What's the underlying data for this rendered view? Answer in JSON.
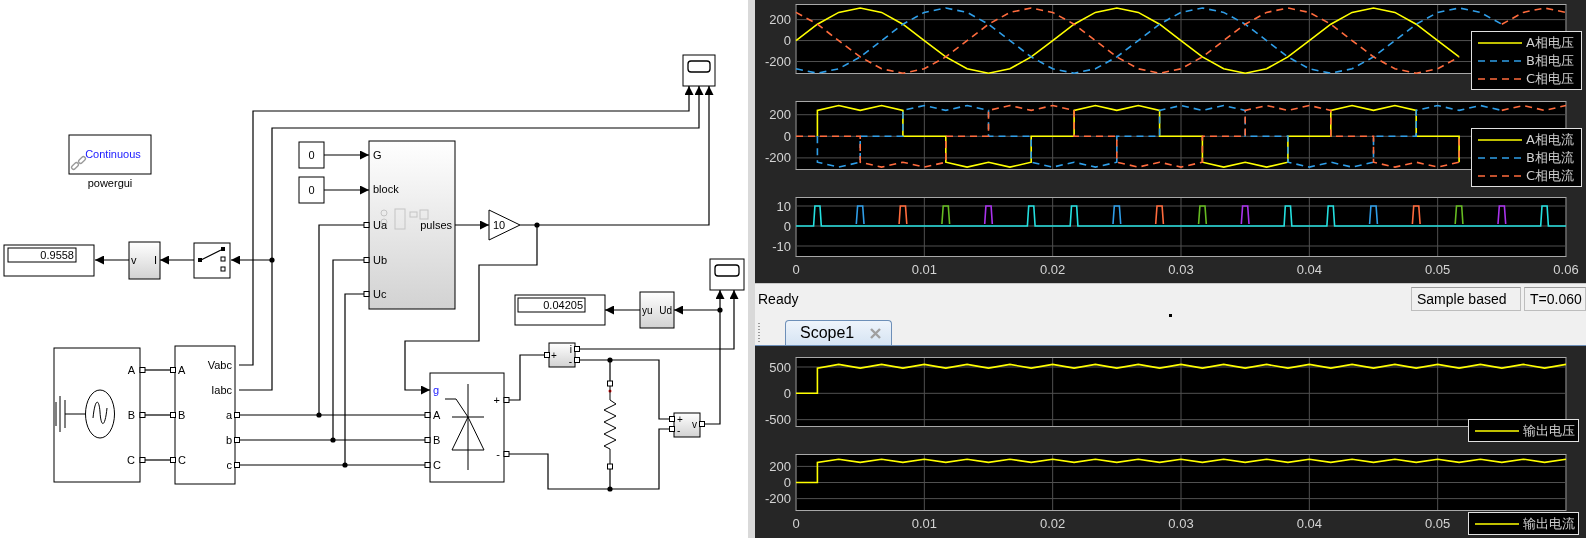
{
  "diagram": {
    "powergui": {
      "mode": "Continuous",
      "caption": "powergui"
    },
    "displays": [
      {
        "value": "0.9558"
      },
      {
        "value": "0.04205"
      }
    ],
    "converter": {
      "left_label": "v",
      "right_label": "I"
    },
    "constants": [
      {
        "value": "0"
      },
      {
        "value": "0"
      }
    ],
    "pulse_generator": {
      "inputs": [
        "G",
        "block",
        "Ua",
        "Ub",
        "Uc"
      ],
      "output": "pulses"
    },
    "gain": {
      "value": "10"
    },
    "ud_block": {
      "left_label": "yu",
      "right_label": "Ud"
    },
    "source": {
      "ports": [
        "A",
        "B",
        "C"
      ]
    },
    "measurement": {
      "inputs": [
        "A",
        "B",
        "C"
      ],
      "outputs": [
        "Vabc",
        "Iabc",
        "a",
        "b",
        "c"
      ]
    },
    "bridge": {
      "gate": "g",
      "inputs": [
        "A",
        "B",
        "C"
      ],
      "outputs": [
        "+",
        "-"
      ]
    },
    "current_meter": {
      "input": "+",
      "outputs": [
        "i",
        "-"
      ]
    },
    "voltage_meter": {
      "inputs": [
        "+",
        "-"
      ],
      "output": "v"
    }
  },
  "scope_window": {
    "axes": [
      {
        "legend": true,
        "chart_data": {
          "type": "line",
          "grid": true,
          "xlim": [
            0,
            0.06
          ],
          "ylim": [
            -319,
            349
          ],
          "yticks": [
            -200,
            0,
            200
          ],
          "x": [
            0,
            0.00167,
            0.00333,
            0.005,
            0.00667,
            0.00833,
            0.01,
            0.01167,
            0.01333,
            0.015,
            0.01667,
            0.01833,
            0.02,
            0.02167,
            0.02333,
            0.025,
            0.02667,
            0.02833,
            0.03,
            0.03167,
            0.03333,
            0.035,
            0.03667,
            0.03833,
            0.04,
            0.04167,
            0.04333,
            0.045,
            0.04667,
            0.04833,
            0.05,
            0.05167,
            0.05333,
            0.055,
            0.05667,
            0.05833,
            0.06
          ],
          "series": [
            {
              "name": "A相电压",
              "color": "#ffff00",
              "line_style": "solid",
              "values": [
                0,
                156,
                269,
                311,
                269,
                156,
                0,
                -156,
                -269,
                -311,
                -269,
                -156,
                0,
                156,
                269,
                311,
                269,
                156,
                0,
                -156,
                -269,
                -311,
                -269,
                -156,
                0,
                156,
                269,
                311,
                269,
                156,
                0,
                -156,
                null,
                null,
                null,
                null,
                null
              ]
            },
            {
              "name": "B相电压",
              "color": "#2f9ee8",
              "line_style": "dashed",
              "values": [
                -269,
                -311,
                -269,
                -156,
                0,
                156,
                269,
                311,
                269,
                156,
                0,
                -156,
                -269,
                -311,
                -269,
                -156,
                0,
                156,
                269,
                311,
                269,
                156,
                0,
                -156,
                -269,
                -311,
                -269,
                -156,
                0,
                156,
                269,
                311,
                269,
                156,
                null,
                null,
                null
              ]
            },
            {
              "name": "C相电压",
              "color": "#ff6b3d",
              "line_style": "dashed",
              "values": [
                269,
                156,
                0,
                -156,
                -269,
                -311,
                -269,
                -156,
                0,
                156,
                269,
                311,
                269,
                156,
                0,
                -156,
                -269,
                -311,
                -269,
                -156,
                0,
                156,
                269,
                311,
                269,
                156,
                0,
                -156,
                -269,
                -311,
                -269,
                -156,
                null,
                156,
                269,
                311,
                269
              ]
            }
          ]
        }
      },
      {
        "legend": true,
        "chart_data": {
          "type": "line",
          "grid": true,
          "xlim": [
            0,
            0.06
          ],
          "ylim": [
            -312,
            327
          ],
          "yticks": [
            -200,
            0,
            200
          ],
          "x": [
            0,
            0.00167,
            0.00167,
            0.00333,
            0.005,
            0.005,
            0.00667,
            0.00833,
            0.00833,
            0.01,
            0.01167,
            0.01167,
            0.01333,
            0.015,
            0.015,
            0.01667,
            0.01833,
            0.01833,
            0.02,
            0.02167,
            0.02167,
            0.02333,
            0.025,
            0.025,
            0.02667,
            0.02833,
            0.02833,
            0.03,
            0.03167,
            0.03167,
            0.03333,
            0.035,
            0.035,
            0.03667,
            0.03833,
            0.03833,
            0.04,
            0.04167,
            0.04167,
            0.04333,
            0.045,
            0.045,
            0.04667,
            0.04833,
            0.04833,
            0.05,
            0.05167,
            0.05167,
            0.05333,
            0.055,
            0.055,
            0.05667,
            0.05833,
            0.05833,
            0.06
          ],
          "series": [
            {
              "name": "A相电流",
              "color": "#ffff00",
              "line_style": "solid",
              "values": [
                null,
                0,
                240,
                285,
                240,
                240,
                285,
                240,
                0,
                0,
                0,
                -240,
                -285,
                -240,
                -240,
                -285,
                -240,
                0,
                0,
                0,
                240,
                285,
                240,
                240,
                285,
                240,
                0,
                0,
                0,
                -240,
                -285,
                -240,
                -240,
                -285,
                -240,
                0,
                0,
                0,
                240,
                285,
                240,
                240,
                285,
                240,
                0,
                0,
                0,
                -240,
                null,
                null,
                null,
                null,
                null,
                null,
                null
              ]
            },
            {
              "name": "B相电流",
              "color": "#2f9ee8",
              "line_style": "dashed",
              "values": [
                null,
                0,
                -240,
                -285,
                -240,
                0,
                0,
                0,
                240,
                285,
                240,
                240,
                285,
                240,
                0,
                0,
                0,
                -240,
                -285,
                -240,
                -240,
                -285,
                -240,
                0,
                0,
                0,
                240,
                285,
                240,
                240,
                285,
                240,
                0,
                0,
                0,
                -240,
                -285,
                -240,
                -240,
                -285,
                -240,
                0,
                0,
                0,
                240,
                285,
                240,
                240,
                285,
                240,
                null,
                null,
                null,
                null,
                null
              ]
            },
            {
              "name": "C相电流",
              "color": "#ff6b3d",
              "line_style": "dashed",
              "values": [
                0,
                0,
                0,
                0,
                0,
                -240,
                -285,
                -240,
                -240,
                -285,
                -240,
                0,
                0,
                0,
                240,
                285,
                240,
                240,
                285,
                240,
                0,
                0,
                0,
                -240,
                -285,
                -240,
                -240,
                -285,
                -240,
                0,
                0,
                0,
                240,
                285,
                240,
                240,
                285,
                240,
                0,
                0,
                0,
                -240,
                -285,
                -240,
                -240,
                -285,
                -240,
                0,
                null,
                null,
                240,
                285,
                240,
                240,
                285
              ]
            }
          ]
        }
      },
      {
        "chart_data": {
          "type": "line",
          "grid": true,
          "xlim": [
            0,
            0.06
          ],
          "ylim": [
            -15.5,
            14.5
          ],
          "yticks": [
            -10,
            0,
            10
          ],
          "xticks": [
            0,
            0.01,
            0.02,
            0.03,
            0.04,
            0.05,
            0.06
          ],
          "x": [
            0,
            0.00137,
            0.00147,
            0.00187,
            0.00197,
            0.0047,
            0.0048,
            0.0052,
            0.0053,
            0.00803,
            0.00813,
            0.00853,
            0.00863,
            0.01137,
            0.01147,
            0.01187,
            0.01197,
            0.0147,
            0.0148,
            0.0152,
            0.0153,
            0.01803,
            0.01813,
            0.01853,
            0.01863,
            0.02137,
            0.02147,
            0.02187,
            0.02197,
            0.0247,
            0.0248,
            0.0252,
            0.0253,
            0.02803,
            0.02813,
            0.02853,
            0.02863,
            0.03137,
            0.03147,
            0.03187,
            0.03197,
            0.0347,
            0.0348,
            0.0352,
            0.0353,
            0.03803,
            0.03813,
            0.03853,
            0.03863,
            0.04137,
            0.04147,
            0.04187,
            0.04197,
            0.0447,
            0.0448,
            0.0452,
            0.0453,
            0.04803,
            0.04813,
            0.04853,
            0.04863,
            0.05137,
            0.05147,
            0.05187,
            0.05197,
            0.0547,
            0.0548,
            0.0552,
            0.0553,
            0.05803,
            0.05813,
            0.05853,
            0.05863,
            0.06
          ],
          "series": [
            {
              "color": "#2f9ee8",
              "values": [
                null,
                null,
                null,
                null,
                null,
                1,
                10,
                10,
                1,
                null,
                null,
                null,
                null,
                null,
                null,
                null,
                null,
                null,
                null,
                null,
                null,
                null,
                null,
                null,
                null,
                null,
                null,
                null,
                null,
                1,
                10,
                10,
                1,
                null,
                null,
                null,
                null,
                null,
                null,
                null,
                null,
                null,
                null,
                null,
                null,
                null,
                null,
                null,
                null,
                null,
                null,
                null,
                null,
                1,
                10,
                10,
                1,
                null,
                null,
                null,
                null,
                null,
                null,
                null,
                null,
                null,
                null,
                null,
                null,
                null,
                null,
                null,
                null,
                null
              ]
            },
            {
              "color": "#ff6b3d",
              "values": [
                null,
                null,
                null,
                null,
                null,
                null,
                null,
                null,
                null,
                1,
                10,
                10,
                1,
                null,
                null,
                null,
                null,
                null,
                null,
                null,
                null,
                null,
                null,
                null,
                null,
                null,
                null,
                null,
                null,
                null,
                null,
                null,
                null,
                1,
                10,
                10,
                1,
                null,
                null,
                null,
                null,
                null,
                null,
                null,
                null,
                null,
                null,
                null,
                null,
                null,
                null,
                null,
                null,
                null,
                null,
                null,
                null,
                1,
                10,
                10,
                1,
                null,
                null,
                null,
                null,
                null,
                null,
                null,
                null,
                null,
                null,
                null,
                null,
                null
              ]
            },
            {
              "color": "#66bb22",
              "values": [
                null,
                null,
                null,
                null,
                null,
                null,
                null,
                null,
                null,
                null,
                null,
                null,
                null,
                1,
                10,
                10,
                1,
                null,
                null,
                null,
                null,
                null,
                null,
                null,
                null,
                null,
                null,
                null,
                null,
                null,
                null,
                null,
                null,
                null,
                null,
                null,
                null,
                1,
                10,
                10,
                1,
                null,
                null,
                null,
                null,
                null,
                null,
                null,
                null,
                null,
                null,
                null,
                null,
                null,
                null,
                null,
                null,
                null,
                null,
                null,
                null,
                1,
                10,
                10,
                1,
                null,
                null,
                null,
                null,
                null,
                null,
                null,
                null,
                null
              ]
            },
            {
              "color": "#aa33ee",
              "values": [
                null,
                null,
                null,
                null,
                null,
                null,
                null,
                null,
                null,
                null,
                null,
                null,
                null,
                null,
                null,
                null,
                null,
                1,
                10,
                10,
                1,
                null,
                null,
                null,
                null,
                null,
                null,
                null,
                null,
                null,
                null,
                null,
                null,
                null,
                null,
                null,
                null,
                null,
                null,
                null,
                null,
                1,
                10,
                10,
                1,
                null,
                null,
                null,
                null,
                null,
                null,
                null,
                null,
                null,
                null,
                null,
                null,
                null,
                null,
                null,
                null,
                null,
                null,
                null,
                null,
                1,
                10,
                10,
                1,
                null,
                null,
                null,
                null,
                null
              ]
            },
            {
              "color": "#24e0e0",
              "values": [
                0,
                0,
                10,
                10,
                0,
                0,
                0,
                0,
                0,
                0,
                0,
                0,
                0,
                0,
                0,
                0,
                0,
                0,
                0,
                0,
                0,
                0,
                10,
                10,
                0,
                0,
                10,
                10,
                0,
                0,
                0,
                0,
                0,
                0,
                0,
                0,
                0,
                0,
                0,
                0,
                0,
                0,
                0,
                0,
                0,
                0,
                10,
                10,
                0,
                0,
                10,
                10,
                0,
                0,
                0,
                0,
                0,
                0,
                0,
                0,
                0,
                0,
                0,
                0,
                0,
                0,
                0,
                0,
                0,
                0,
                10,
                10,
                0,
                0
              ]
            }
          ]
        }
      }
    ],
    "status_bar": {
      "status": "Ready",
      "sample_mode": "Sample based",
      "time": "T=0.060"
    }
  },
  "scope1": {
    "tab": {
      "title": "Scope1",
      "selected": true
    },
    "axes": [
      {
        "legend": true,
        "chart_data": {
          "type": "line",
          "grid": true,
          "xlim": [
            0,
            0.06
          ],
          "ylim": [
            -640,
            690
          ],
          "yticks": [
            -500,
            0,
            500
          ],
          "x": [
            0,
            0.00167,
            0.00167,
            0.00333,
            0.005,
            0.00667,
            0.00833,
            0.01,
            0.01167,
            0.01333,
            0.015,
            0.01667,
            0.01833,
            0.02,
            0.02167,
            0.02333,
            0.025,
            0.02667,
            0.02833,
            0.03,
            0.03167,
            0.03333,
            0.035,
            0.03667,
            0.03833,
            0.04,
            0.04167,
            0.04333,
            0.045,
            0.04667,
            0.04833,
            0.05,
            0.05167,
            0.05333,
            0.055,
            0.05667,
            0.05833,
            0.06
          ],
          "series": [
            {
              "name": "输出电压",
              "color": "#ffff00",
              "line_style": "solid",
              "values": [
                0,
                0,
                480,
                550,
                480,
                550,
                480,
                550,
                480,
                550,
                480,
                550,
                480,
                550,
                480,
                550,
                480,
                550,
                480,
                550,
                480,
                550,
                480,
                550,
                480,
                550,
                480,
                550,
                480,
                550,
                480,
                550,
                480,
                550,
                480,
                550,
                480,
                550
              ]
            }
          ]
        }
      },
      {
        "legend": true,
        "chart_data": {
          "type": "line",
          "grid": true,
          "xlim": [
            0,
            0.06
          ],
          "ylim": [
            -354,
            354
          ],
          "yticks": [
            -200,
            0,
            200
          ],
          "xticks": [
            0,
            0.01,
            0.02,
            0.03,
            0.04,
            0.05
          ],
          "x": [
            0,
            0.00167,
            0.00167,
            0.00333,
            0.005,
            0.00667,
            0.00833,
            0.01,
            0.01167,
            0.01333,
            0.015,
            0.01667,
            0.01833,
            0.02,
            0.02167,
            0.02333,
            0.025,
            0.02667,
            0.02833,
            0.03,
            0.03167,
            0.03333,
            0.035,
            0.03667,
            0.03833,
            0.04,
            0.04167,
            0.04333,
            0.045,
            0.04667,
            0.04833,
            0.05,
            0.05167,
            0.05333,
            0.055,
            0.05667,
            0.05833,
            0.06
          ],
          "series": [
            {
              "name": "输出电流",
              "color": "#ffff00",
              "line_style": "solid",
              "values": [
                0,
                0,
                250,
                290,
                250,
                290,
                250,
                290,
                250,
                290,
                250,
                290,
                250,
                290,
                250,
                290,
                250,
                290,
                250,
                290,
                250,
                290,
                250,
                290,
                250,
                290,
                250,
                290,
                250,
                290,
                250,
                290,
                250,
                290,
                250,
                290,
                250,
                290
              ]
            }
          ]
        }
      }
    ]
  }
}
